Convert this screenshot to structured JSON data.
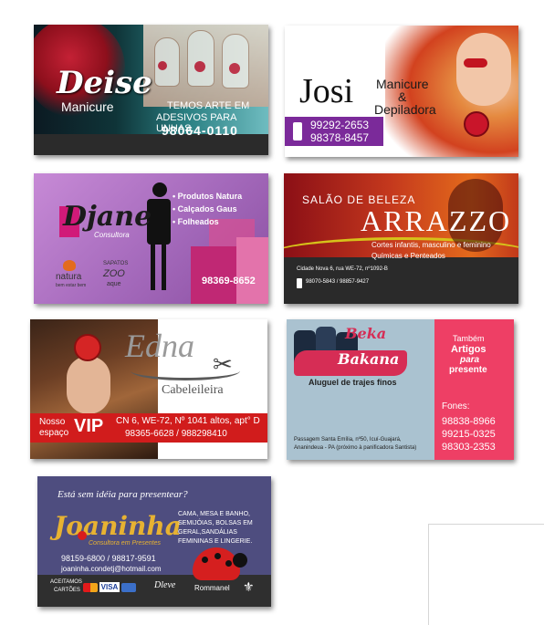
{
  "cards": {
    "deise": {
      "name": "Deise",
      "role": "Manicure",
      "slogan1": "TEMOS ARTE EM",
      "slogan2": "ADESIVOS PARA UNHAS.",
      "phone": "98064-0110"
    },
    "josi": {
      "name": "Josi",
      "role1": "Manicure",
      "role2": "&",
      "role3": "Depiladora",
      "phone1": "99292-2653",
      "phone2": "98378-8457"
    },
    "djane": {
      "name": "Djane",
      "subtitle": "Consultora",
      "items": [
        "• Produtos Natura",
        "• Calçados Gaus",
        "• Folheados"
      ],
      "brand1": "natura",
      "brand1_tag": "bem estar bem",
      "brand2": "SAPATOS",
      "brand2_mark": "ZOO",
      "brand2_sub": "aque",
      "phone": "98369-8652"
    },
    "arrazzo": {
      "top": "SALÃO DE BELEZA",
      "name": "ARRAZZO",
      "services1": "Cortes infantis, masculino e feminino",
      "services2": "Químicas e Penteados",
      "address": "Cidade Nova 6, rua WE-72, nº1092-B",
      "phones": "98070-5843 / 98857-9427"
    },
    "edna": {
      "name": "Edna",
      "role": "Cabeleileira",
      "promo_small": "Nosso",
      "promo_small2": "espaço",
      "promo_big": "VIP",
      "address": "CN 6, WE-72, Nº 1041 altos, apt° D",
      "phones": "98365-6628 / 988298410"
    },
    "beka": {
      "name1": "Beka",
      "name2": "Bakana",
      "tagline": "Aluguel de trajes finos",
      "side1": "Também",
      "side2": "Artigos",
      "side3": "para",
      "side4": "presente",
      "fones_label": "Fones:",
      "phones": [
        "98838-8966",
        "99215-0325",
        "98303-2353"
      ],
      "address1": "Passagem Santa Emília, nº50, Icuí-Guajará,",
      "address2": "Ananindeua - PA (próximo à panificadora Santista)"
    },
    "joaninha": {
      "question": "Está sem idéia para presentear?",
      "name": "Joaninha",
      "subtitle": "Consultora em Presentes",
      "products": [
        "CAMA, MESA E BANHO,",
        "SEMIJÓIAS, BOLSAS EM",
        "GERAL,SANDÁLIAS",
        "FEMININAS E LINGERIE."
      ],
      "phones": "98159-6800 / 98817-9591",
      "email": "joaninha.condetj@hotmail.com",
      "accepted1": "ACEITAMOS",
      "accepted2": "CARTÕES",
      "visa": "VISA",
      "dleve": "Dleve",
      "rommanel": "Rommanel"
    }
  }
}
